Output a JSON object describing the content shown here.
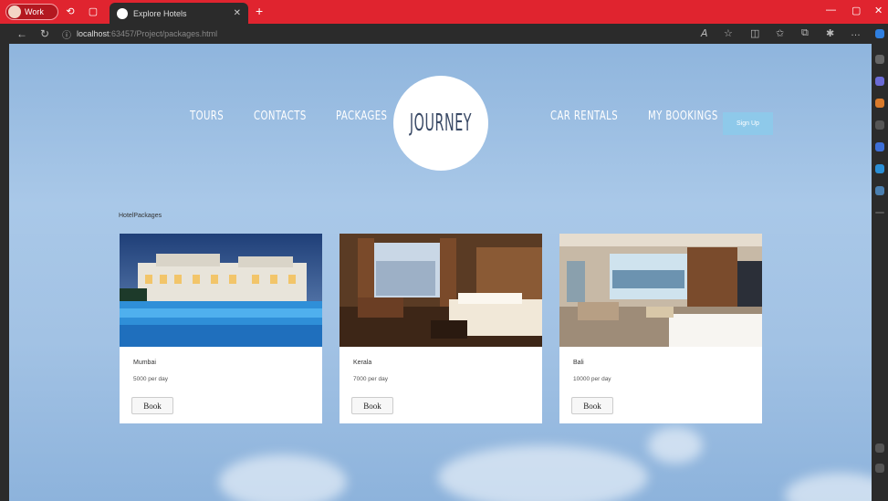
{
  "browser": {
    "profile_label": "Work",
    "tab_title": "Explore Hotels",
    "url_host": "localhost",
    "url_rest": ":63457/Project/packages.html"
  },
  "site": {
    "nav_left": [
      "TOURS",
      "CONTACTS",
      "PACKAGES"
    ],
    "logo": "JOURNEY",
    "nav_right": [
      "CAR RENTALS",
      "MY BOOKINGS"
    ],
    "signup_label": "Sign Up",
    "section_title": "HotelPackages"
  },
  "cards": [
    {
      "name": "Mumbai",
      "price": "5000 per day",
      "book_label": "Book"
    },
    {
      "name": "Kerala",
      "price": "7000 per day",
      "book_label": "Book"
    },
    {
      "name": "Bali",
      "price": "10000 per day",
      "book_label": "Book"
    }
  ],
  "colors": {
    "browser_accent": "#e0242f",
    "signup_bg": "#8ec9ea",
    "logo_text": "#3a4a66"
  }
}
